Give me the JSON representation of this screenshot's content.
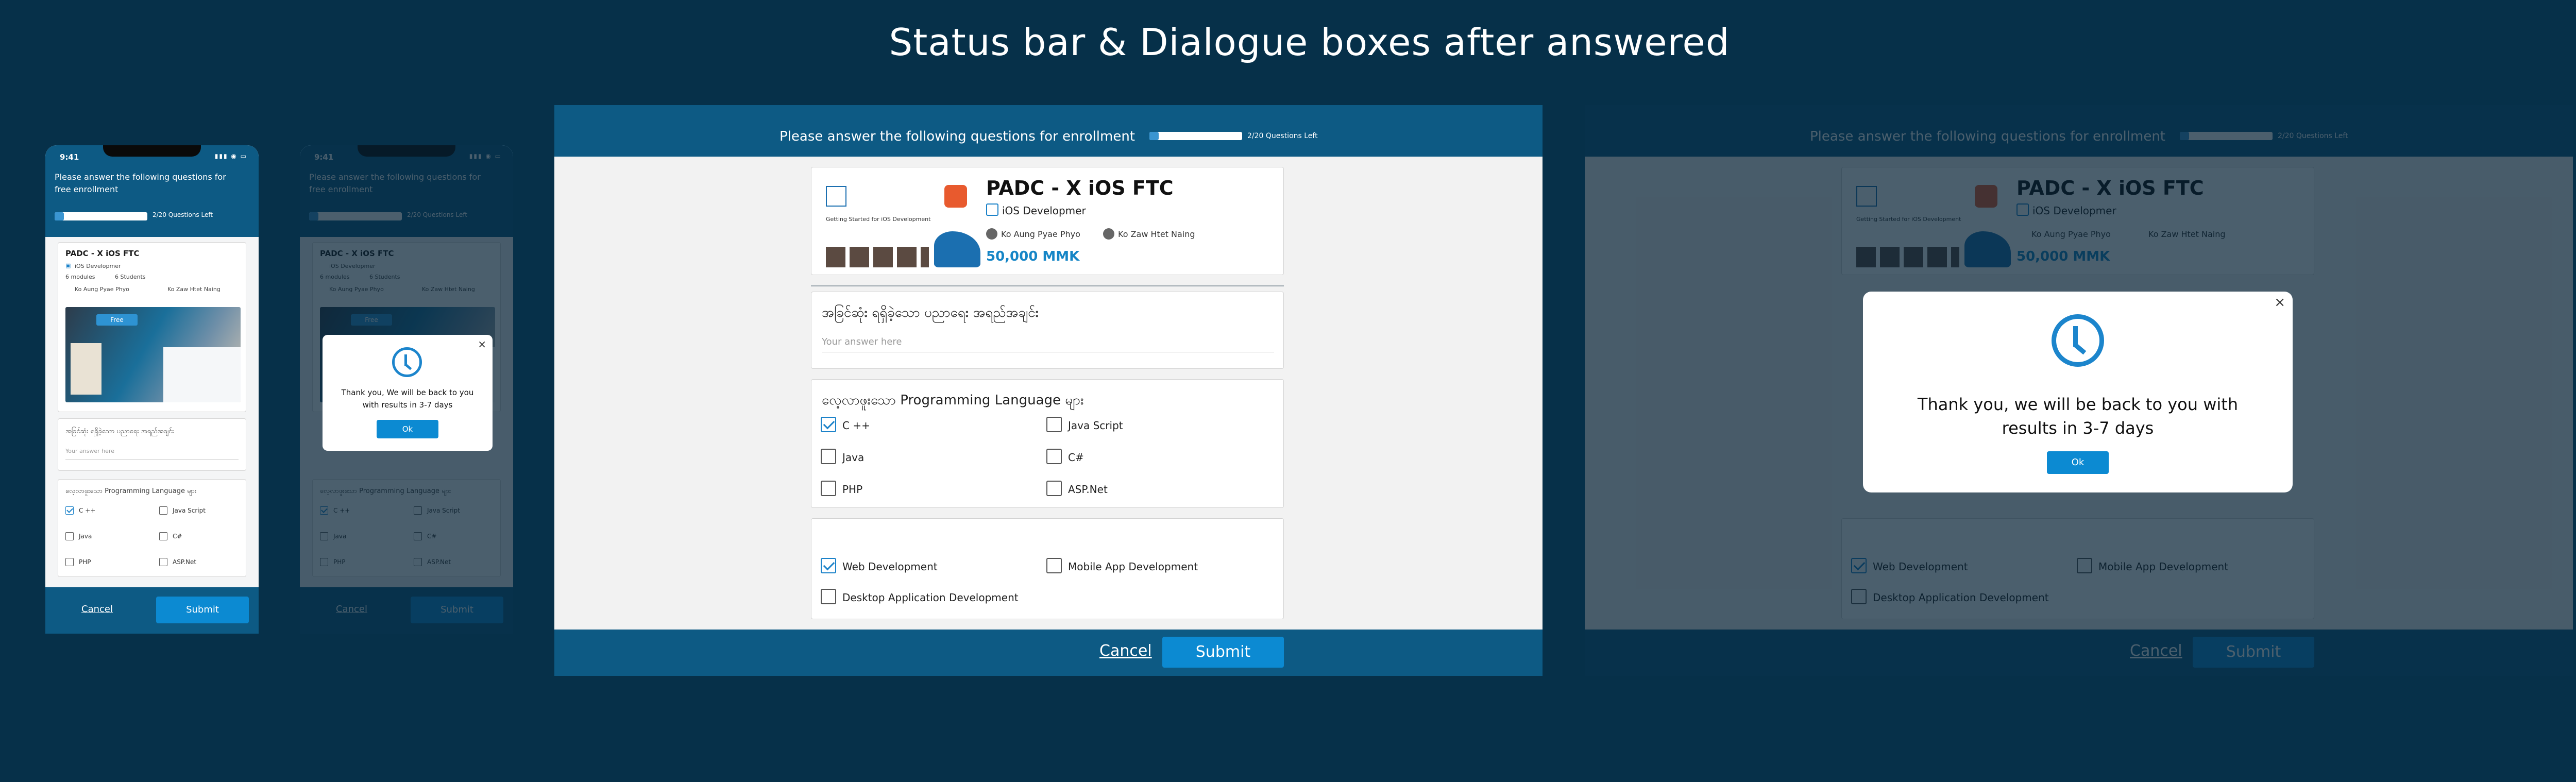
{
  "title": "Status bar & Dialogue boxes after answered",
  "course": {
    "name": "PADC - X iOS FTC",
    "category": "iOS Developmer",
    "modules": "6 modules",
    "students": "6 Students",
    "instructors": [
      "Ko Aung Pyae Phyo",
      "Ko Zaw Htet Naing"
    ],
    "price": "50,000 MMK",
    "thumb_line1": "Getting Started for iOS Development",
    "thumb_badge": "Free"
  },
  "status": {
    "question_mobile": "Please answer the following questions for free enrollment",
    "question_web": "Please answer the following questions for enrollment",
    "left": "2/20 Questions Left",
    "progress": 0.1
  },
  "questions": {
    "q1": "အခြင်ဆုံး ရရှိခဲ့သော ပညာရေး အရည်အချင်း",
    "q1_placeholder": "Your answer here",
    "q2": "လေ့လာဖူးသော Programming Language များ",
    "languages": [
      {
        "label": "C ++",
        "checked": true
      },
      {
        "label": "Java Script",
        "checked": false
      },
      {
        "label": "Java",
        "checked": false
      },
      {
        "label": "C#",
        "checked": false
      },
      {
        "label": "PHP",
        "checked": false
      },
      {
        "label": "ASP.Net",
        "checked": false
      }
    ],
    "fields": [
      {
        "label": "Web Development",
        "checked": true
      },
      {
        "label": "Mobile App Development",
        "checked": false
      },
      {
        "label": "Desktop Application Development",
        "checked": false
      }
    ]
  },
  "footer": {
    "cancel": "Cancel",
    "submit": "Submit"
  },
  "dialog": {
    "message_mobile": "Thank you, We will be back to you with results in 3-7 days",
    "message_web": "Thank you, we will be back to you with results in 3-7 days",
    "ok": "Ok",
    "close": "×"
  },
  "phone": {
    "time": "9:41"
  },
  "colors": {
    "background": "#063049",
    "header": "#0d5a84",
    "accent": "#0c8ad2",
    "price": "#1585c6"
  },
  "icons": [
    "clock-icon",
    "close-icon",
    "checkbox-icon",
    "developer-icon",
    "avatar-icon"
  ]
}
